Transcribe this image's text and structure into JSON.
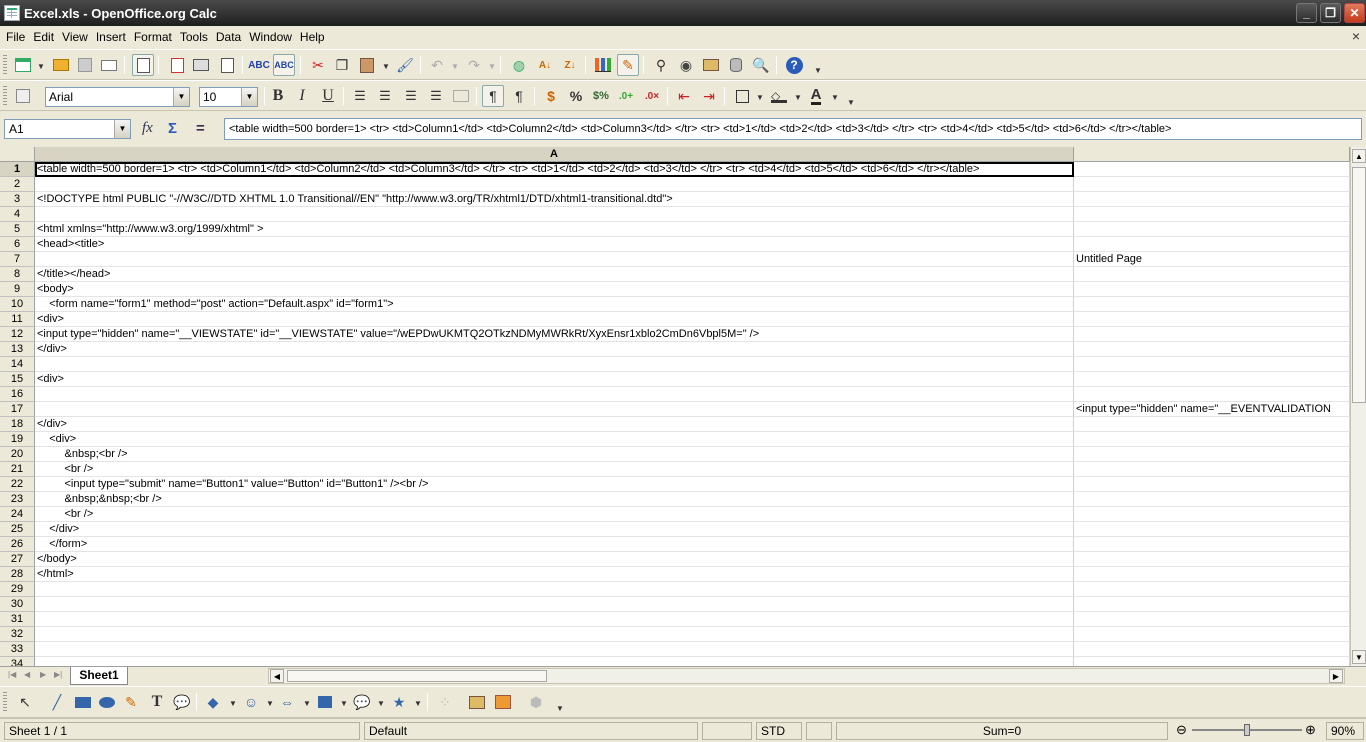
{
  "window": {
    "title": "Excel.xls - OpenOffice.org Calc",
    "minimize": "_",
    "maximize": "❐",
    "close": "✕"
  },
  "menu": {
    "items": [
      "File",
      "Edit",
      "View",
      "Insert",
      "Format",
      "Tools",
      "Data",
      "Window",
      "Help"
    ],
    "doc_close": "×"
  },
  "format_bar": {
    "font_name": "Arial",
    "font_size": "10"
  },
  "formula_bar": {
    "cell_ref": "A1",
    "formula_text": "<table width=500 border=1> <tr> <td>Column1</td> <td>Column2</td> <td>Column3</td> </tr> <tr> <td>1</td> <td>2</td> <td>3</td> </tr> <tr> <td>4</td> <td>5</td> <td>6</td> </tr></table>",
    "fx": "fx",
    "sum": "Σ",
    "equals": "="
  },
  "grid": {
    "columns": [
      "A",
      ""
    ],
    "rows": [
      {
        "num": "1",
        "a": "<table width=500 border=1> <tr> <td>Column1</td> <td>Column2</td> <td>Column3</td> </tr> <tr> <td>1</td> <td>2</td> <td>3</td> </tr> <tr> <td>4</td> <td>5</td> <td>6</td> </tr></table>",
        "b": ""
      },
      {
        "num": "2",
        "a": "",
        "b": ""
      },
      {
        "num": "3",
        "a": "<!DOCTYPE html PUBLIC \"-//W3C//DTD XHTML 1.0 Transitional//EN\" \"http://www.w3.org/TR/xhtml1/DTD/xhtml1-transitional.dtd\">",
        "b": ""
      },
      {
        "num": "4",
        "a": "",
        "b": ""
      },
      {
        "num": "5",
        "a": "<html xmlns=\"http://www.w3.org/1999/xhtml\" >",
        "b": ""
      },
      {
        "num": "6",
        "a": "<head><title>",
        "b": ""
      },
      {
        "num": "7",
        "a": "",
        "b": "Untitled Page"
      },
      {
        "num": "8",
        "a": "</title></head>",
        "b": ""
      },
      {
        "num": "9",
        "a": "<body>",
        "b": ""
      },
      {
        "num": "10",
        "a": "    <form name=\"form1\" method=\"post\" action=\"Default.aspx\" id=\"form1\">",
        "b": ""
      },
      {
        "num": "11",
        "a": "<div>",
        "b": ""
      },
      {
        "num": "12",
        "a": "<input type=\"hidden\" name=\"__VIEWSTATE\" id=\"__VIEWSTATE\" value=\"/wEPDwUKMTQ2OTkzNDMyMWRkRt/XyxEnsr1xblo2CmDn6Vbpl5M=\" />",
        "b": ""
      },
      {
        "num": "13",
        "a": "</div>",
        "b": ""
      },
      {
        "num": "14",
        "a": "",
        "b": ""
      },
      {
        "num": "15",
        "a": "<div>",
        "b": ""
      },
      {
        "num": "16",
        "a": "",
        "b": ""
      },
      {
        "num": "17",
        "a": "",
        "b": "<input type=\"hidden\" name=\"__EVENTVALIDATION"
      },
      {
        "num": "18",
        "a": "</div>",
        "b": ""
      },
      {
        "num": "19",
        "a": "    <div>",
        "b": ""
      },
      {
        "num": "20",
        "a": "         &nbsp;<br />",
        "b": ""
      },
      {
        "num": "21",
        "a": "         <br />",
        "b": ""
      },
      {
        "num": "22",
        "a": "         <input type=\"submit\" name=\"Button1\" value=\"Button\" id=\"Button1\" /><br />",
        "b": ""
      },
      {
        "num": "23",
        "a": "         &nbsp;&nbsp;<br />",
        "b": ""
      },
      {
        "num": "24",
        "a": "         <br />",
        "b": ""
      },
      {
        "num": "25",
        "a": "    </div>",
        "b": ""
      },
      {
        "num": "26",
        "a": "    </form>",
        "b": ""
      },
      {
        "num": "27",
        "a": "</body>",
        "b": ""
      },
      {
        "num": "28",
        "a": "</html>",
        "b": ""
      },
      {
        "num": "29",
        "a": "",
        "b": ""
      },
      {
        "num": "30",
        "a": "",
        "b": ""
      },
      {
        "num": "31",
        "a": "",
        "b": ""
      },
      {
        "num": "32",
        "a": "",
        "b": ""
      },
      {
        "num": "33",
        "a": "",
        "b": ""
      },
      {
        "num": "34",
        "a": "",
        "b": ""
      }
    ]
  },
  "sheet_tabs": {
    "active": "Sheet1"
  },
  "status": {
    "sheet": "Sheet 1 / 1",
    "style": "Default",
    "mode": "STD",
    "sum": "Sum=0",
    "zoom": "90%",
    "zoom_level": 0.5
  },
  "icons": {
    "standard": [
      "new-icon",
      "open-icon",
      "save-icon",
      "email-icon",
      "edit-file-icon",
      "export-pdf-icon",
      "print-icon",
      "page-preview-icon",
      "spellcheck-icon",
      "autospellcheck-icon",
      "cut-icon",
      "copy-icon",
      "paste-icon",
      "format-paintbrush-icon",
      "undo-icon",
      "redo-icon",
      "hyperlink-icon",
      "sort-ascending-icon",
      "sort-descending-icon",
      "chart-icon",
      "show-draw-functions-icon",
      "find-replace-icon",
      "navigator-icon",
      "gallery-icon",
      "data-sources-icon",
      "zoom-icon",
      "help-icon"
    ],
    "formatting": [
      "styles-icon",
      "bold-icon",
      "italic-icon",
      "underline-icon",
      "align-left-icon",
      "align-center-icon",
      "align-right-icon",
      "justify-icon",
      "merge-cells-icon",
      "left-to-right-icon",
      "right-to-left-icon",
      "currency-icon",
      "percent-icon",
      "standard-format-icon",
      "add-decimal-icon",
      "delete-decimal-icon",
      "decrease-indent-icon",
      "increase-indent-icon",
      "borders-icon",
      "background-color-icon",
      "font-color-icon"
    ],
    "drawing": [
      "select-icon",
      "line-icon",
      "rectangle-icon",
      "ellipse-icon",
      "freeform-icon",
      "text-icon",
      "callout-icon",
      "basic-shapes-icon",
      "symbol-shapes-icon",
      "block-arrows-icon",
      "flowcharts-icon",
      "callouts-icon",
      "stars-icon",
      "points-icon",
      "from-file-icon",
      "fontwork-icon",
      "extrusion-icon"
    ]
  }
}
